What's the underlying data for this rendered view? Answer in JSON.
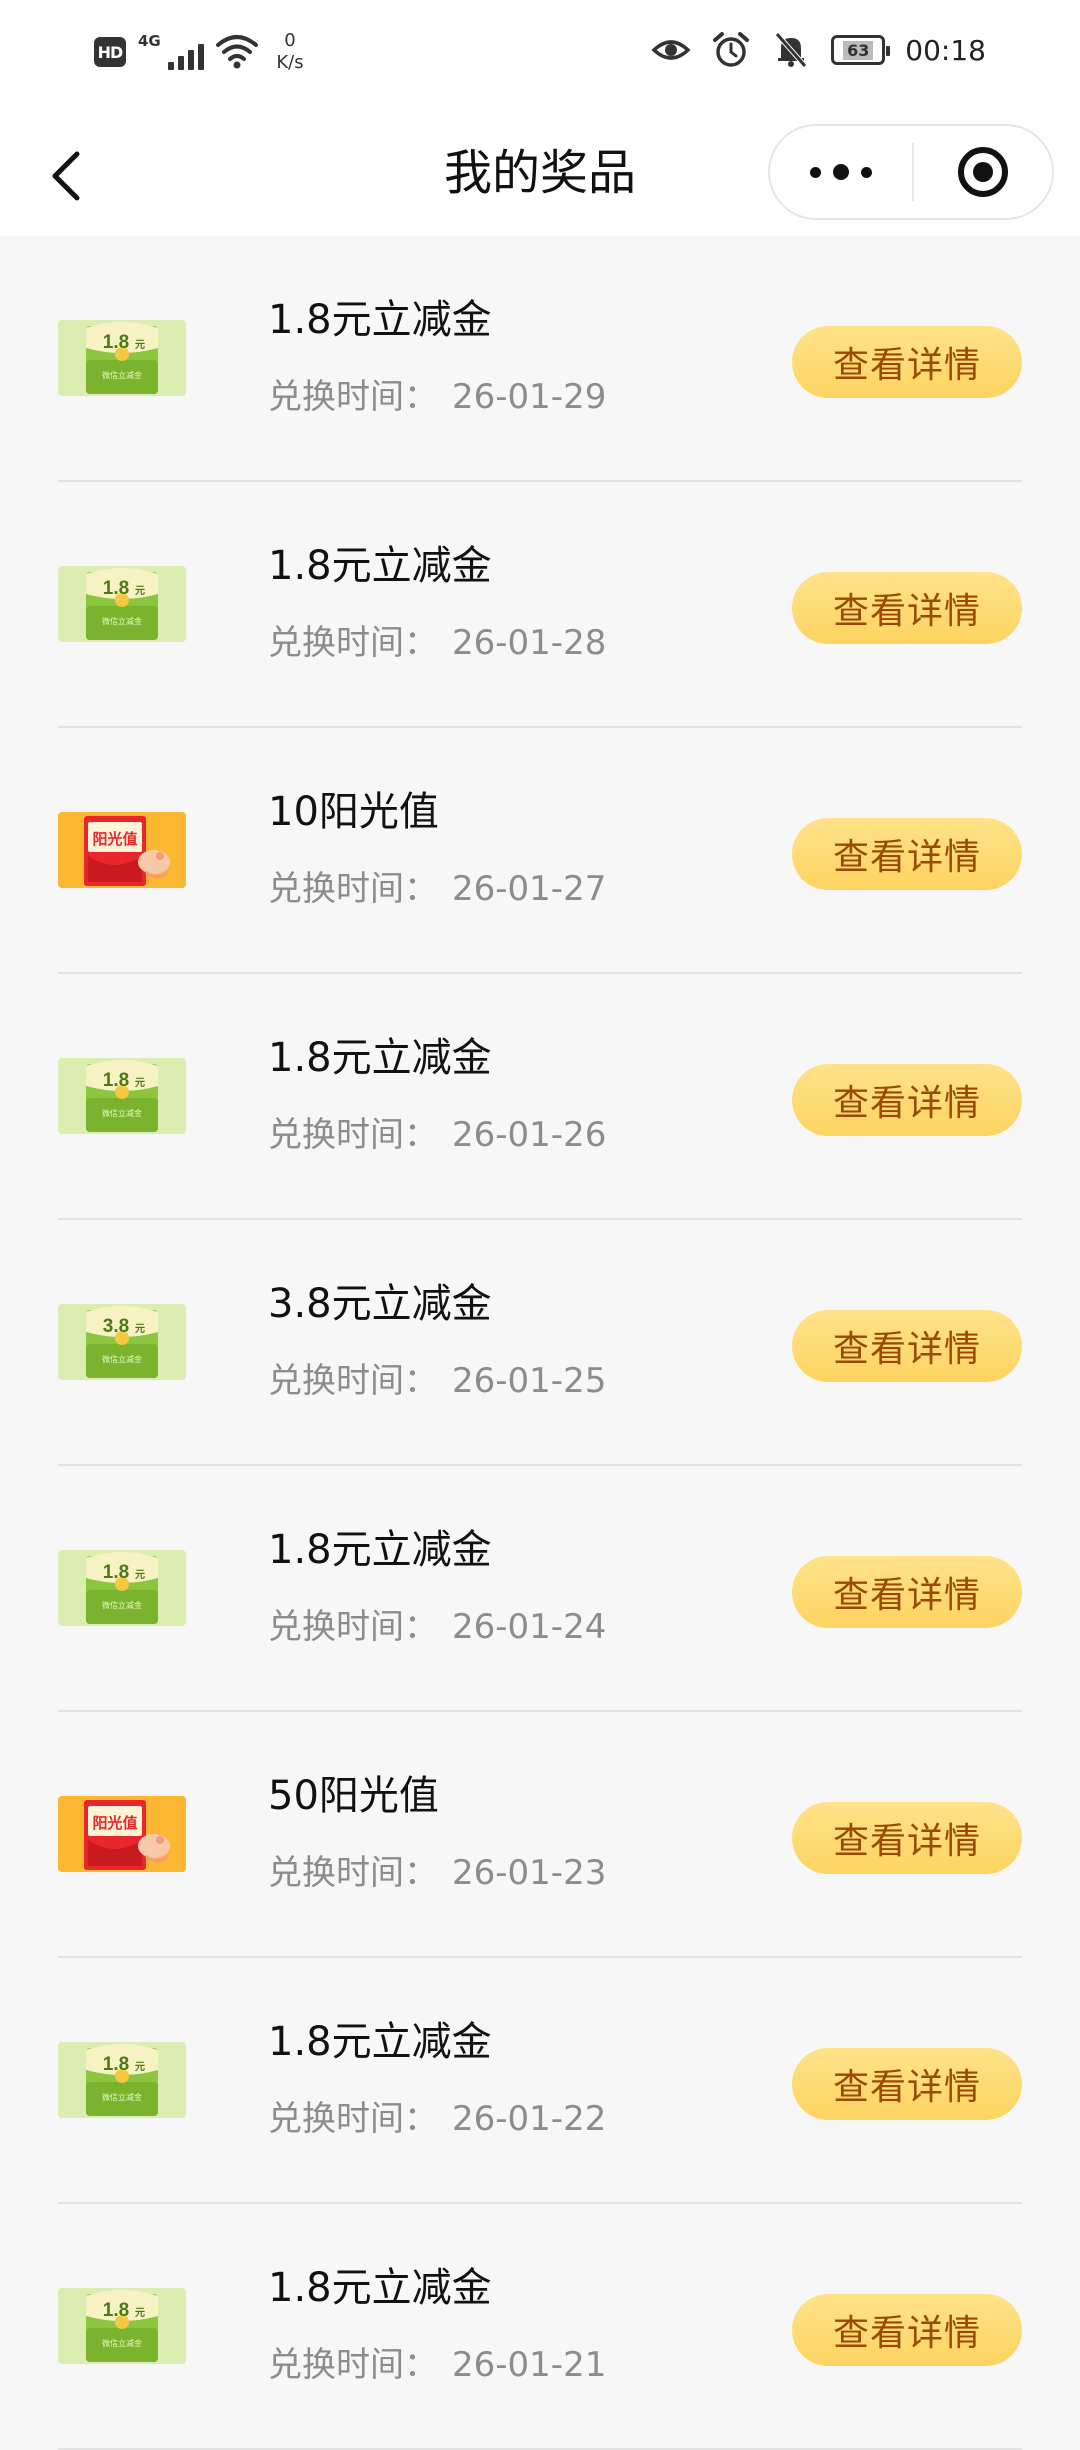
{
  "status_bar": {
    "hd": "HD",
    "network": "4G",
    "speed_value": "0",
    "speed_unit": "K/s",
    "battery": "63",
    "time": "00:18"
  },
  "nav": {
    "title": "我的奖品"
  },
  "list": {
    "date_prefix": "兑换时间：",
    "button_label": "查看详情",
    "items": [
      {
        "name": "1.8元立减金",
        "date": "26-01-29",
        "icon": "green-cash-envelope-icon",
        "badge": "1.8",
        "badge_unit": "元",
        "sub": "微信立减金"
      },
      {
        "name": "1.8元立减金",
        "date": "26-01-28",
        "icon": "green-cash-envelope-icon",
        "badge": "1.8",
        "badge_unit": "元",
        "sub": "微信立减金"
      },
      {
        "name": "10阳光值",
        "date": "26-01-27",
        "icon": "sunshine-gift-icon",
        "badge": "阳光值"
      },
      {
        "name": "1.8元立减金",
        "date": "26-01-26",
        "icon": "green-cash-envelope-icon",
        "badge": "1.8",
        "badge_unit": "元",
        "sub": "微信立减金"
      },
      {
        "name": "3.8元立减金",
        "date": "26-01-25",
        "icon": "green-cash-envelope-icon",
        "badge": "3.8",
        "badge_unit": "元",
        "sub": "微信立减金"
      },
      {
        "name": "1.8元立减金",
        "date": "26-01-24",
        "icon": "green-cash-envelope-icon",
        "badge": "1.8",
        "badge_unit": "元",
        "sub": "微信立减金"
      },
      {
        "name": "50阳光值",
        "date": "26-01-23",
        "icon": "sunshine-gift-icon",
        "badge": "阳光值"
      },
      {
        "name": "1.8元立减金",
        "date": "26-01-22",
        "icon": "green-cash-envelope-icon",
        "badge": "1.8",
        "badge_unit": "元",
        "sub": "微信立减金"
      },
      {
        "name": "1.8元立减金",
        "date": "26-01-21",
        "icon": "green-cash-envelope-icon",
        "badge": "1.8",
        "badge_unit": "元",
        "sub": "微信立减金"
      }
    ]
  },
  "colors": {
    "background": "#f7f7f7",
    "button_bg": "#fdd461",
    "button_text": "#9a4a00",
    "green_card": "#8cc63f",
    "orange_card": "#fbb731",
    "red_envelope": "#e8262b"
  }
}
